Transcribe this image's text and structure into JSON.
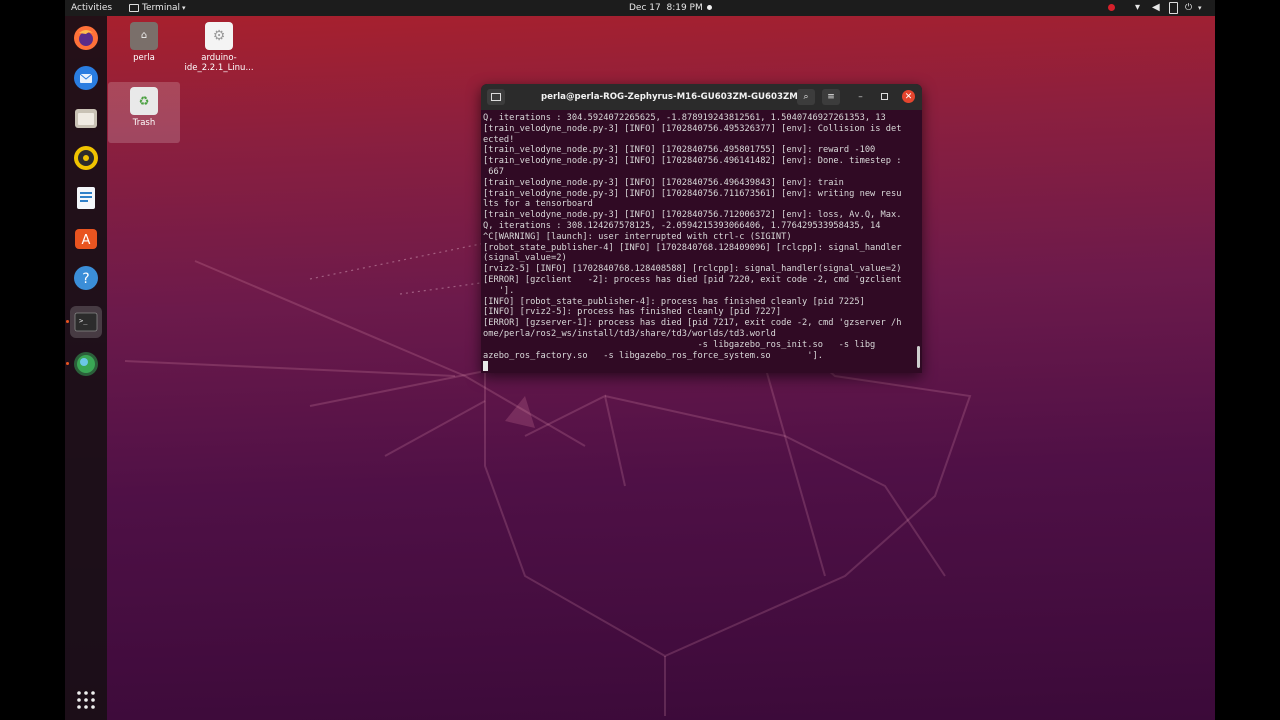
{
  "topbar": {
    "activities": "Activities",
    "app_menu": "Terminal",
    "date": "Dec 17",
    "time": "8:19 PM"
  },
  "dock": {
    "items": [
      {
        "name": "firefox-icon",
        "color": "#ff7139"
      },
      {
        "name": "thunderbird-icon",
        "color": "#2a7de1"
      },
      {
        "name": "files-icon",
        "color": "#c9c2b5"
      },
      {
        "name": "rhythmbox-icon",
        "color": "#f0c300"
      },
      {
        "name": "writer-icon",
        "color": "#2f80c9"
      },
      {
        "name": "software-icon",
        "color": "#e95420"
      },
      {
        "name": "help-icon",
        "color": "#3b8ed8"
      },
      {
        "name": "terminal-icon",
        "color": "#2c2c2c"
      },
      {
        "name": "globe-icon",
        "color": "#3aa655"
      }
    ],
    "show_apps": "show-apps-icon"
  },
  "desktop": {
    "icons": [
      {
        "label": "perla",
        "icon": "home-folder-icon"
      },
      {
        "label": "arduino-ide_2.2.1_Linu...",
        "icon": "arduino-icon"
      },
      {
        "label": "Trash",
        "icon": "trash-icon"
      }
    ]
  },
  "terminal": {
    "title": "perla@perla-ROG-Zephyrus-M16-GU603ZM-GU603ZM: ~",
    "lines": [
      "Q, iterations : 304.5924072265625, -1.878919243812561, 1.5040746927261353, 13",
      "[train_velodyne_node.py-3] [INFO] [1702840756.495326377] [env]: Collision is det",
      "ected!",
      "[train_velodyne_node.py-3] [INFO] [1702840756.495801755] [env]: reward -100",
      "[train_velodyne_node.py-3] [INFO] [1702840756.496141482] [env]: Done. timestep :",
      " 667",
      "[train_velodyne_node.py-3] [INFO] [1702840756.496439843] [env]: train",
      "[train_velodyne_node.py-3] [INFO] [1702840756.711673561] [env]: writing new resu",
      "lts for a tensorboard",
      "[train_velodyne_node.py-3] [INFO] [1702840756.712006372] [env]: loss, Av.Q, Max.",
      "Q, iterations : 308.124267578125, -2.0594215393066406, 1.776429533958435, 14",
      "^C[WARNING] [launch]: user interrupted with ctrl-c (SIGINT)",
      "[robot_state_publisher-4] [INFO] [1702840768.128409096] [rclcpp]: signal_handler",
      "(signal_value=2)",
      "[rviz2-5] [INFO] [1702840768.128408588] [rclcpp]: signal_handler(signal_value=2)",
      "[ERROR] [gzclient   -2]: process has died [pid 7220, exit code -2, cmd 'gzclient",
      "   '].",
      "[INFO] [robot_state_publisher-4]: process has finished cleanly [pid 7225]",
      "[INFO] [rviz2-5]: process has finished cleanly [pid 7227]",
      "[ERROR] [gzserver-1]: process has died [pid 7217, exit code -2, cmd 'gzserver /h",
      "ome/perla/ros2_ws/install/td3/share/td3/worlds/td3.world",
      "                                         -s libgazebo_ros_init.so   -s libg",
      "azebo_ros_factory.so   -s libgazebo_ros_force_system.so       '].",
      ""
    ]
  },
  "colors": {
    "terminal_bg": "#300a24",
    "header_bg": "#2b2b2b",
    "close_button": "#e5452e",
    "accent": "#e95420"
  }
}
